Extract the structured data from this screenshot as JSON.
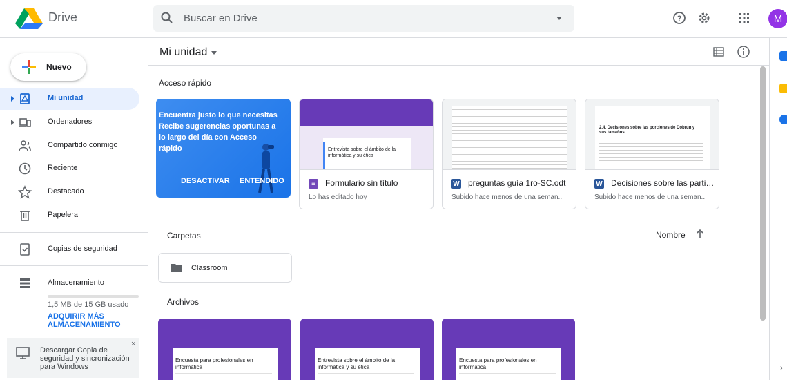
{
  "header": {
    "app_name": "Drive",
    "search_placeholder": "Buscar en Drive",
    "avatar_letter": "M"
  },
  "sidebar": {
    "new_label": "Nuevo",
    "items": [
      {
        "label": "Mi unidad",
        "icon": "drive-icon",
        "active": true,
        "expandable": true
      },
      {
        "label": "Ordenadores",
        "icon": "computers-icon",
        "active": false,
        "expandable": true
      },
      {
        "label": "Compartido conmigo",
        "icon": "shared-icon",
        "active": false
      },
      {
        "label": "Reciente",
        "icon": "clock-icon",
        "active": false
      },
      {
        "label": "Destacado",
        "icon": "star-icon",
        "active": false
      },
      {
        "label": "Papelera",
        "icon": "trash-icon",
        "active": false
      },
      {
        "label": "Copias de seguridad",
        "icon": "backup-icon",
        "active": false
      },
      {
        "label": "Almacenamiento",
        "icon": "storage-icon",
        "active": false
      }
    ],
    "storage_text": "1,5 MB de 15 GB usado",
    "storage_fraction": 0.001,
    "buy_link": "ADQUIRIR MÁS ALMACENAMIENTO",
    "promo_text": "Descargar Copia de seguridad y sincronización para Windows",
    "promo_close": "×"
  },
  "main": {
    "title": "Mi unidad",
    "quick_access_label": "Acceso rápido",
    "promo_card": {
      "text": "Encuentra justo lo que necesitas Recibe sugerencias oportunas a lo largo del día con Acceso rápido",
      "dismiss_label": "DESACTIVAR",
      "accept_label": "ENTENDIDO"
    },
    "quick_files": [
      {
        "name": "Formulario sin título",
        "subtitle": "Lo has editado hoy",
        "type": "forms",
        "icon_letter": "≡",
        "color": "#7248b9",
        "thumb_title": "Entrevista sobre el ámbito de la informática y su ética"
      },
      {
        "name": "preguntas guía 1ro-SC.odt",
        "subtitle": "Subido hace menos de una seman...",
        "type": "word",
        "icon_letter": "W",
        "color": "#2a5699"
      },
      {
        "name": "Decisiones sobre las partic...",
        "subtitle": "Subido hace menos de una seman...",
        "type": "word",
        "icon_letter": "W",
        "color": "#2a5699",
        "thumb_title": "2.4. Decisiones sobre las porciones de Dobrun y sus tamaños"
      }
    ],
    "folders_label": "Carpetas",
    "sort_label": "Nombre",
    "folders": [
      {
        "name": "Classroom"
      }
    ],
    "files_label": "Archivos",
    "files": [
      {
        "title": "Encuesta para profesionales en informática"
      },
      {
        "title": "Entrevista sobre el ámbito de la informática y su ética"
      },
      {
        "title": "Encuesta para profesionales en informática"
      }
    ]
  }
}
